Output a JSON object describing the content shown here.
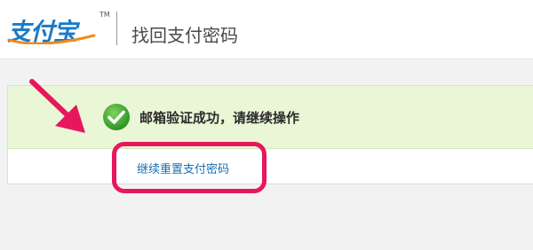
{
  "header": {
    "logo_text": "支付宝",
    "logo_tm": "TM",
    "title": "找回支付密码"
  },
  "banner": {
    "message": "邮箱验证成功，请继续操作",
    "icon": "check-circle-icon"
  },
  "actions": {
    "reset_link": "继续重置支付密码"
  },
  "colors": {
    "banner_bg": "#eaf7d7",
    "link": "#1a6fb3",
    "annotation": "#e8175d",
    "check": "#3aa32a"
  }
}
